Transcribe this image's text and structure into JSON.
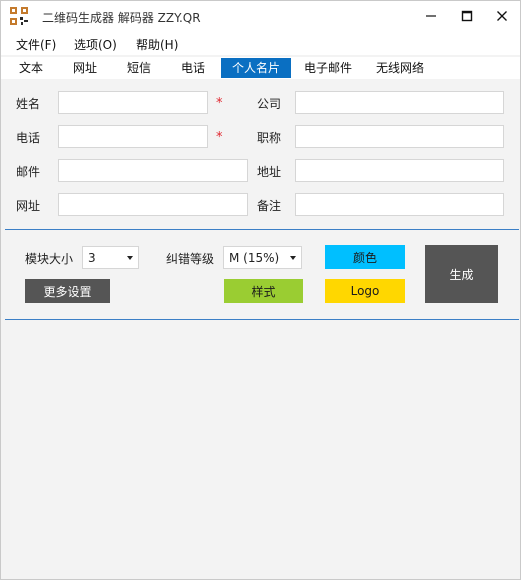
{
  "window": {
    "title": "二维码生成器 解码器 ZZY.QR"
  },
  "menu": [
    "文件(F)",
    "选项(O)",
    "帮助(H)"
  ],
  "tabs": [
    "文本",
    "网址",
    "短信",
    "电话",
    "个人名片",
    "电子邮件",
    "无线网络"
  ],
  "active_tab": "个人名片",
  "form": {
    "name_label": "姓名",
    "name_value": "",
    "phone_label": "电话",
    "phone_value": "",
    "email_label": "邮件",
    "email_value": "",
    "url_label": "网址",
    "url_value": "",
    "company_label": "公司",
    "company_value": "",
    "title_label": "职称",
    "title_value": "",
    "address_label": "地址",
    "address_value": "",
    "note_label": "备注",
    "note_value": "",
    "required_mark": "*"
  },
  "settings": {
    "module_size_label": "模块大小",
    "module_size_value": "3",
    "error_level_label": "纠错等级",
    "error_level_value": "M (15%)",
    "more_settings": "更多设置",
    "style": "样式",
    "color": "颜色",
    "logo": "Logo",
    "generate": "生成"
  },
  "colors": {
    "active_tab": "#0a6fc2",
    "required": "#e0262e",
    "style_button": "#9acd32",
    "color_button": "#00bfff",
    "logo_button": "#ffd700",
    "dark_button": "#555555",
    "divider": "#3b7fc6"
  }
}
